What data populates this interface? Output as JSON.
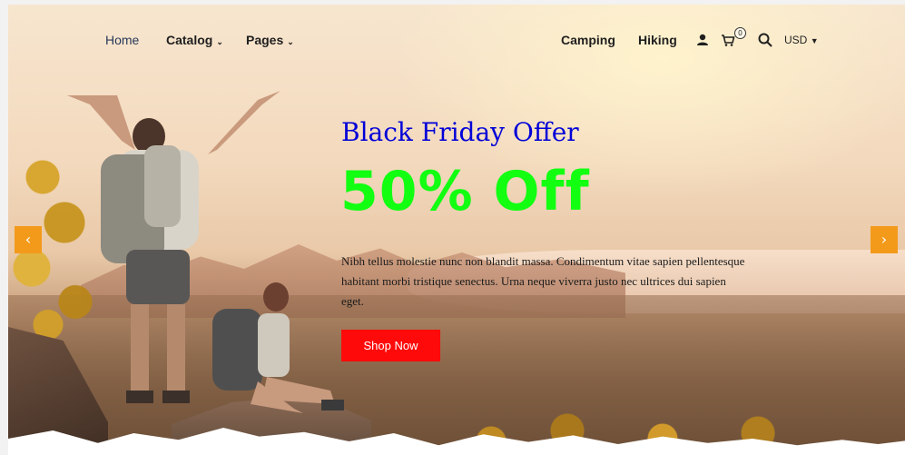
{
  "nav": {
    "left": [
      {
        "label": "Home",
        "has_dropdown": false,
        "active": true
      },
      {
        "label": "Catalog",
        "has_dropdown": true
      },
      {
        "label": "Pages",
        "has_dropdown": true
      }
    ],
    "right": [
      {
        "label": "Camping"
      },
      {
        "label": "Hiking"
      }
    ],
    "icons": [
      "user-icon",
      "cart-icon",
      "search-icon"
    ],
    "cart_count": "0",
    "currency": "USD"
  },
  "hero": {
    "eyebrow": "Black Friday Offer",
    "headline": "50% Off",
    "body": "Nibh tellus molestie nunc non blandit massa. Condimentum vitae sapien pellentesque habitant morbi tristique senectus. Urna neque viverra justo nec ultrices dui sapien eget.",
    "cta_label": "Shop Now"
  },
  "carousel": {
    "prev_icon": "chevron-left-icon",
    "next_icon": "chevron-right-icon"
  },
  "colors": {
    "eyebrow": "#0000d8",
    "headline": "#12ff12",
    "cta": "#ff0a0a",
    "arrow": "#f39a1b"
  }
}
